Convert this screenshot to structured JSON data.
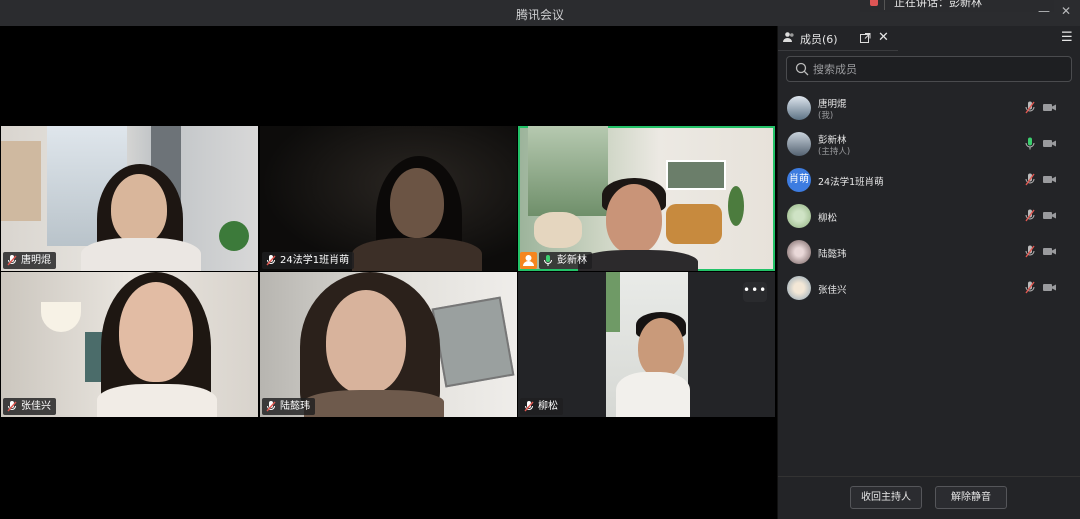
{
  "window": {
    "title": "腾讯会议",
    "minimize": "—",
    "close": "✕",
    "speaking_notice": "正在讲话：彭新林"
  },
  "panel": {
    "title": "成员(6)",
    "popout_icon": "popout-icon",
    "close_label": "✕",
    "menu_label": "☰",
    "search_placeholder": "搜索成员",
    "members": [
      {
        "name": "唐明焜",
        "role": "(我)",
        "avatar": "photo",
        "mic": "muted",
        "cam": "off"
      },
      {
        "name": "彭新林",
        "role": "(主持人)",
        "avatar": "photo",
        "mic": "on",
        "cam": "off"
      },
      {
        "name": "24法学1班肖萌",
        "role": "",
        "avatar": "肖萌",
        "mic": "muted",
        "cam": "off"
      },
      {
        "name": "柳松",
        "role": "",
        "avatar": "photo",
        "mic": "muted",
        "cam": "off"
      },
      {
        "name": "陆懿玮",
        "role": "",
        "avatar": "photo",
        "mic": "muted",
        "cam": "off"
      },
      {
        "name": "张佳兴",
        "role": "",
        "avatar": "photo",
        "mic": "muted",
        "cam": "off"
      }
    ],
    "reclaim_host_button": "收回主持人",
    "unmute_all_button": "解除静音"
  },
  "tiles": [
    {
      "name": "唐明焜",
      "mic": "muted"
    },
    {
      "name": "24法学1班肖萌",
      "mic": "muted"
    },
    {
      "name": "彭新林",
      "mic": "on",
      "host": true,
      "active_speaker": true
    },
    {
      "name": "张佳兴",
      "mic": "muted"
    },
    {
      "name": "陆懿玮",
      "mic": "muted"
    },
    {
      "name": "柳松",
      "mic": "muted",
      "more": "•••"
    }
  ],
  "colors": {
    "active_border": "#23c268",
    "muted_mic": "#e0564f",
    "host_badge": "#f5861f",
    "avatar_text_bg": "#3d7ce0"
  }
}
